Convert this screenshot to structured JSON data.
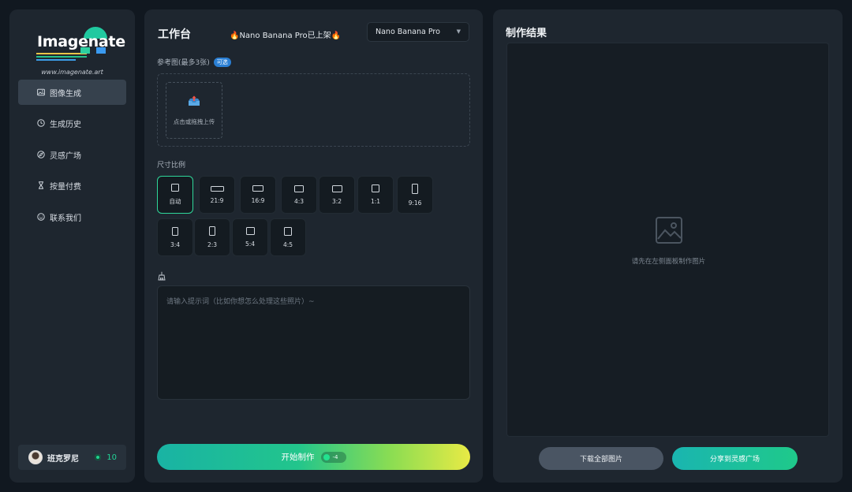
{
  "sidebar": {
    "logo_text": "Imagenate",
    "logo_url": "www.imagenate.art",
    "items": [
      {
        "label": "图像生成",
        "icon": "image-icon",
        "active": true
      },
      {
        "label": "生成历史",
        "icon": "clock-icon",
        "active": false
      },
      {
        "label": "灵感广场",
        "icon": "compass-icon",
        "active": false
      },
      {
        "label": "按量付费",
        "icon": "hourglass-icon",
        "active": false
      },
      {
        "label": "联系我们",
        "icon": "smile-icon",
        "active": false
      }
    ],
    "user": {
      "name": "班克罗尼",
      "credits": "10"
    }
  },
  "workbench": {
    "title": "工作台",
    "notice": "🔥Nano Banana Pro已上架🔥",
    "model": "Nano Banana Pro",
    "reference_label": "参考图(最多3张)",
    "reference_badge": "可选",
    "upload_label": "点击或拖拽上传",
    "size_label": "尺寸比例",
    "ratios": [
      "自动",
      "21:9",
      "16:9",
      "4:3",
      "3:2",
      "1:1",
      "9:16",
      "3:4",
      "2:3",
      "5:4",
      "4:5"
    ],
    "selected_ratio": "自动",
    "prompt_placeholder": "请输入提示词（比如你想怎么处理这些照片）~",
    "start_label": "开始制作",
    "cost": "-4"
  },
  "result": {
    "title": "制作结果",
    "placeholder": "请先在左侧面板制作图片",
    "download_label": "下载全部图片",
    "share_label": "分享到灵感广场"
  },
  "colors": {
    "accent": "#22c58c",
    "accent_yellow": "#e8ea45",
    "panel": "#1e262f",
    "background": "#111820"
  }
}
